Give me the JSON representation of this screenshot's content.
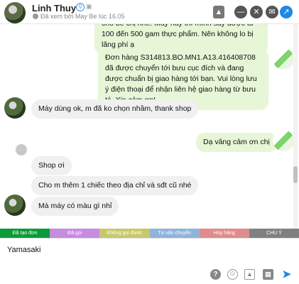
{
  "header": {
    "name": "Linh Thuy",
    "seen": "Đã xem bởi May Be lúc 16.05"
  },
  "messages": [
    {
      "dir": "out",
      "text": "cho bé chị nhé. Máy này thì mình sấy được từ 100 đến 500 gam thực phẩm. Nên không lo bị lãng phí ạ"
    },
    {
      "dir": "out",
      "text": "Đơn hàng S314813.BO.MN1.A13.416408708 đã được chuyển tới bưu cục đích và đang được chuẩn bị giao hàng tới bạn. Vui lòng lưu ý điện thoại để nhận liên hệ giao hàng từ bưu tá. Xin cảm ơn!"
    },
    {
      "dir": "in",
      "text": "Máy dùng ok, m đã ko chọn nhầm, thank shop"
    },
    {
      "dir": "out",
      "text": "Dạ vâng cảm ơn chị"
    },
    {
      "dir": "in",
      "text": "Shop ơi"
    },
    {
      "dir": "in",
      "text": "Cho m thêm 1 chiếc theo địa chỉ và sđt cũ nhé"
    },
    {
      "dir": "in",
      "text": "Mà máy có màu gì nhỉ"
    }
  ],
  "tags": [
    {
      "label": "Đã tạo đơn",
      "color": "#0a9b3a"
    },
    {
      "label": "Đã gọi",
      "color": "#c78be0"
    },
    {
      "label": "Không gọi được",
      "color": "#c8c86a"
    },
    {
      "label": "Tư vấn chuyển",
      "color": "#8fb4dc"
    },
    {
      "label": "Hủy hàng",
      "color": "#e08c8c"
    },
    {
      "label": "CHÚ Ý",
      "color": "#808080"
    }
  ],
  "input": {
    "value": "Yamasaki"
  }
}
